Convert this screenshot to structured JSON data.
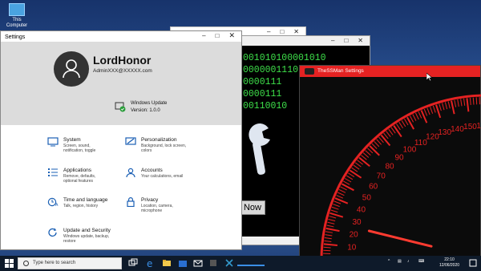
{
  "desktop": {
    "icon_label": "This Computer"
  },
  "back_window2": {
    "binary_lines": [
      "001010100001010",
      "0000001110",
      "0000111",
      "0000111",
      "00110010"
    ],
    "now_button": "Now"
  },
  "settings": {
    "title": "Settings",
    "user_name": "LordHonor",
    "user_email": "AdminXXX@XXXXX.com",
    "update_title": "Windows Update",
    "update_version": "Version: 1.0.0",
    "categories": [
      {
        "name": "System",
        "desc": "Screen, sound,\nnotification, toggle",
        "icon": "monitor-icon"
      },
      {
        "name": "Personalization",
        "desc": "Background, lock screen,\ncolors",
        "icon": "paintbrush-icon"
      },
      {
        "name": "Applications",
        "desc": "Remove, defaults,\noptional features",
        "icon": "apps-list-icon"
      },
      {
        "name": "Accounts",
        "desc": "Your calculations, email",
        "icon": "person-icon"
      },
      {
        "name": "Time and language",
        "desc": "Talk, region, history",
        "icon": "clock-language-icon"
      },
      {
        "name": "Privacy",
        "desc": "Location, camera,\nmicrophone",
        "icon": "lock-icon"
      },
      {
        "name": "Update and Security",
        "desc": "Windows update, backup,\nrestore",
        "icon": "refresh-icon"
      }
    ]
  },
  "gauge_window": {
    "title": "TheSSMan Settings",
    "accent": "#e52222",
    "scale_labels": [
      "0",
      "10",
      "20",
      "30",
      "40",
      "50",
      "60",
      "70",
      "80",
      "90",
      "100",
      "110",
      "120",
      "130",
      "140",
      "150",
      "160",
      "170",
      "180"
    ],
    "needle_value": 25
  },
  "taskbar": {
    "search_placeholder": "Type here to search",
    "time": "22:10",
    "date": "12/06/2020",
    "icons": [
      "task-view-icon",
      "edge-icon",
      "file-explorer-icon",
      "store-icon",
      "mail-icon",
      "app-icon",
      "app-icon",
      "app-icon",
      "app-icon"
    ]
  }
}
